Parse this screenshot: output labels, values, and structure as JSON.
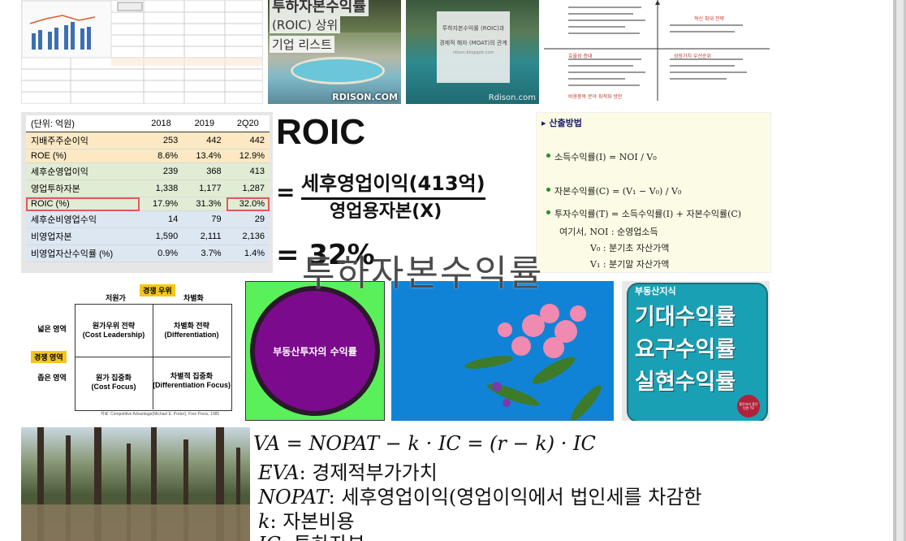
{
  "tiles": {
    "t1": {
      "kind": "spreadsheet-chart"
    },
    "t2": {
      "line1": "투하자본수익률",
      "line2": "(ROIC) 상위",
      "line3": "기업 리스트",
      "watermark": "RDISON.COM"
    },
    "t3": {
      "line1": "투하자본수익률 (ROIC)과",
      "line2": "경제적 해자 (MOAT)의 관계",
      "sub": "rdison.blogspot.com",
      "watermark": "Rdison.com"
    },
    "t4": {
      "left_head": "효율성 증대",
      "right_head": "혁신 확대 전략",
      "bottom_left": "비용중복 분야 최적화 방안",
      "bottom_right": "성장가치 우선순위"
    },
    "roic_table": {
      "unit": "(단위: 억원)",
      "cols": [
        "2018",
        "2019",
        "2Q20"
      ],
      "rows": [
        {
          "label": "지배주주순이익",
          "values": [
            "253",
            "442",
            "442"
          ]
        },
        {
          "label": "ROE (%)",
          "values": [
            "8.6%",
            "13.4%",
            "12.9%"
          ]
        },
        {
          "label": "세후순영업이익",
          "values": [
            "239",
            "368",
            "413"
          ]
        },
        {
          "label": "영업투하자본",
          "values": [
            "1,338",
            "1,177",
            "1,287"
          ]
        },
        {
          "label": "ROIC (%)",
          "values": [
            "17.9%",
            "31.3%",
            "32.0%"
          ]
        },
        {
          "label": "세후순비영업수익",
          "values": [
            "14",
            "79",
            "29"
          ]
        },
        {
          "label": "비영업자본",
          "values": [
            "1,590",
            "2,111",
            "2,136"
          ]
        },
        {
          "label": "비영업자산수익률 (%)",
          "values": [
            "0.9%",
            "3.7%",
            "1.4%"
          ]
        }
      ]
    },
    "roic_formula": {
      "title": "ROIC",
      "numerator": "세후영업이익(413억)",
      "denominator": "영업용자본(X)",
      "eq": "=",
      "result": "= 32%"
    },
    "calc": {
      "heading": "▸ 산출방법",
      "f1": "소득수익률(I) = NOI / V₀",
      "f2": "자본수익률(C) = (V₁ − V₀) / V₀",
      "f3": "투자수익률(T) = 소득수익률(I) + 자본수익률(C)",
      "w1": "여기서, NOI : 순영업소득",
      "w2": "V₀ : 분기초 자산가액",
      "w3": "V₁ : 분기말 자산가액"
    },
    "porter": {
      "top_badge": "경쟁 우위",
      "col1": "저원가",
      "col2": "차별화",
      "row1": "넓은 영역",
      "row2": "좁은 영역",
      "side_badge": "경쟁 영역",
      "q1": "원가우위 전략",
      "q1en": "(Cost Leadership)",
      "q2": "차별화 전략",
      "q2en": "(Differentiation)",
      "q3": "원가 집중화",
      "q3en": "(Cost Focus)",
      "q4": "차별적 집중화",
      "q4en": "(Differentiation Focus)",
      "source": "자료: Competitive Advantage(Michael E. Porter), Free Press, 1985"
    },
    "purple": {
      "label": "부동산투자의 수익률"
    },
    "realestate": {
      "tag": "부동산지식",
      "l1": "기대수익률",
      "l2": "요구수익률",
      "l3": "실현수익률",
      "badge": "좋은자리 좋은인연 TV"
    },
    "eva": {
      "l1": "VA = NOPAT − k · IC = (r − k) · IC",
      "l2a": "EVA",
      "l2b": ": 경제적부가가치",
      "l3a": "NOPAT",
      "l3b": ": 세후영업이익(영업이익에서 법인세를 차감한",
      "l4a": "k",
      "l4b": ": 자본비용",
      "l5a": "IC",
      "l5b": ": 투하자본"
    }
  },
  "overlay_caption": "투하자본수익률",
  "colors": {
    "purple": "#7b0a8c",
    "green": "#5af05a",
    "teal": "#1aa0b4",
    "note_bg": "#fcfce6"
  }
}
